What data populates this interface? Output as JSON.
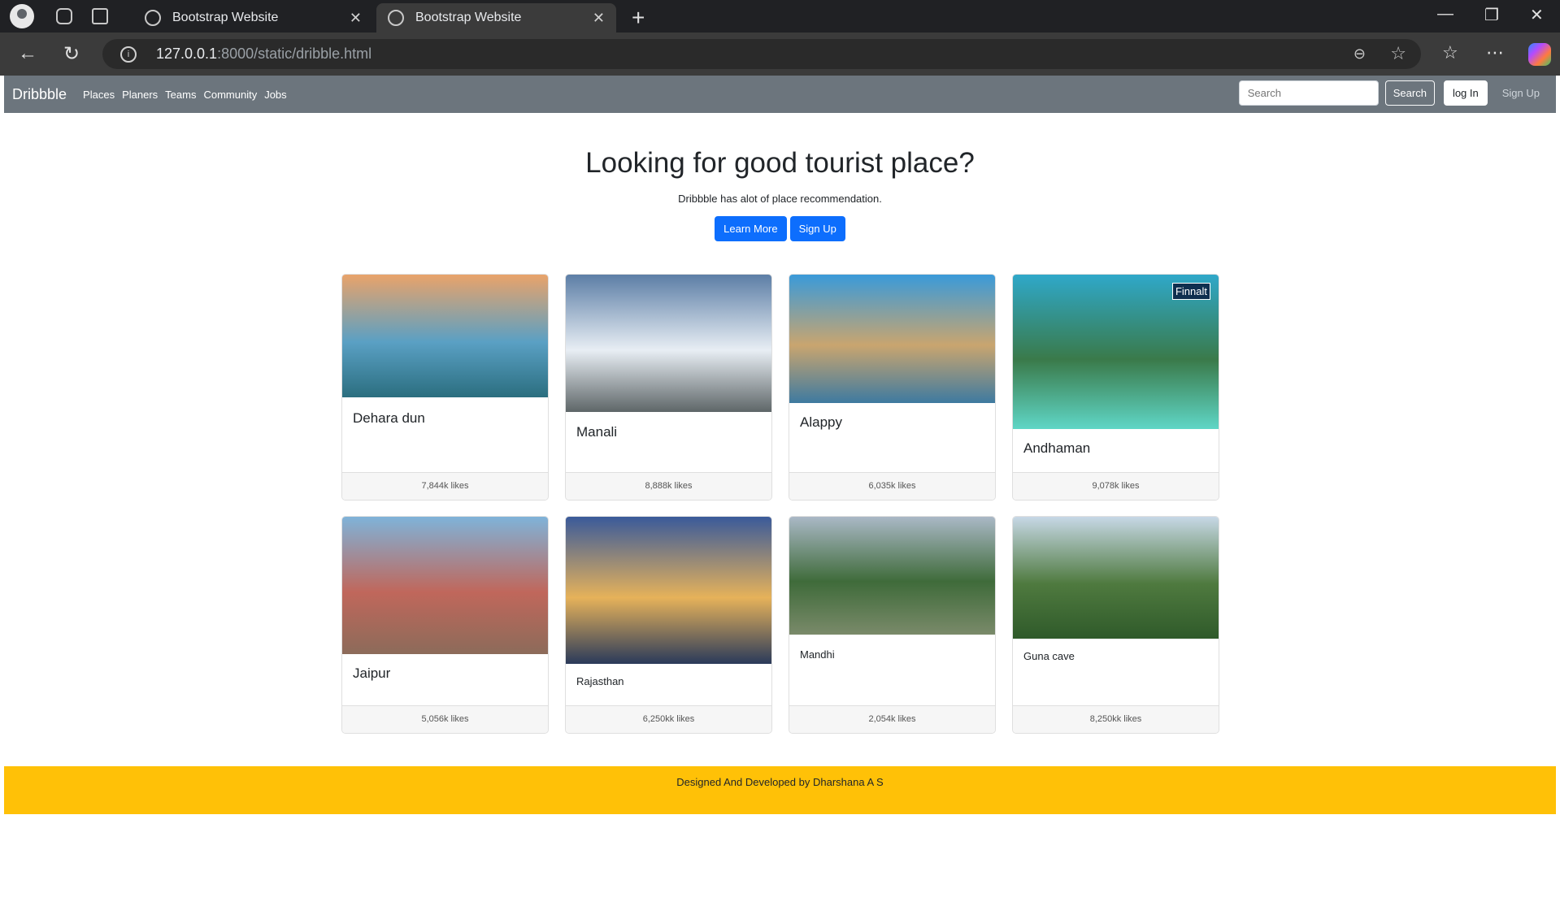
{
  "browser": {
    "tabs": [
      {
        "title": "Bootstrap Website",
        "close": "✕"
      },
      {
        "title": "Bootstrap Website",
        "close": "✕"
      }
    ],
    "new_tab": "+",
    "url_host": "127.0.0.1",
    "url_rest": ":8000/static/dribble.html",
    "icons": [
      "profile-icon",
      "workspaces-icon",
      "tab-actions-icon",
      "back-icon",
      "refresh-icon",
      "info-icon",
      "zoom-out-icon",
      "favorite-star-icon",
      "favorites-icon",
      "more-icon",
      "copilot-icon",
      "minimize-icon",
      "restore-icon",
      "window-close-icon"
    ]
  },
  "navbar": {
    "brand": "Dribbble",
    "links": [
      "Places",
      "Planers",
      "Teams",
      "Community",
      "Jobs"
    ],
    "search_placeholder": "Search",
    "search_button": "Search",
    "login_button": "log In",
    "signup_link": "Sign Up"
  },
  "hero": {
    "title": "Looking for good tourist place?",
    "subtitle": "Dribbble has alot of place recommendation.",
    "learn_more": "Learn More",
    "sign_up": "Sign Up"
  },
  "cards": [
    {
      "title": "Dehara dun",
      "likes": "7,844k likes",
      "image_colors": [
        "#e9a36a",
        "#5aa0c4",
        "#2b6e7f"
      ]
    },
    {
      "title": "Manali",
      "likes": "8,888k likes",
      "image_colors": [
        "#5c7ea6",
        "#e8eef4",
        "#5e6668"
      ]
    },
    {
      "title": "Alappy",
      "likes": "6,035k likes",
      "image_colors": [
        "#3a9ad9",
        "#c9a56f",
        "#3e7aa0"
      ]
    },
    {
      "title": "Andhaman",
      "likes": "9,078k likes",
      "image_colors": [
        "#2fa8c9",
        "#3a7a4a",
        "#5fd6c6"
      ],
      "watermark": "Finnalt"
    },
    {
      "title": "Jaipur",
      "likes": "5,056k likes",
      "image_colors": [
        "#7fb3d9",
        "#c0675b",
        "#8c6b5a"
      ]
    },
    {
      "title": "Rajasthan",
      "likes": "6,250kk likes",
      "image_colors": [
        "#3a5a9a",
        "#e6b25a",
        "#2a3a5a"
      ]
    },
    {
      "title": "Mandhi",
      "likes": "2,054k likes",
      "image_colors": [
        "#aab8c6",
        "#3f6b3a",
        "#7a8a6a"
      ]
    },
    {
      "title": "Guna cave",
      "likes": "8,250kk likes",
      "image_colors": [
        "#c7d8e6",
        "#4f7a3f",
        "#2f5a2a"
      ]
    }
  ],
  "footer": {
    "text": "Designed And Developed by Dharshana A S"
  },
  "colors": {
    "navbar_bg": "#6c757d",
    "primary": "#0d6efd",
    "footer_bg": "#ffc107"
  }
}
